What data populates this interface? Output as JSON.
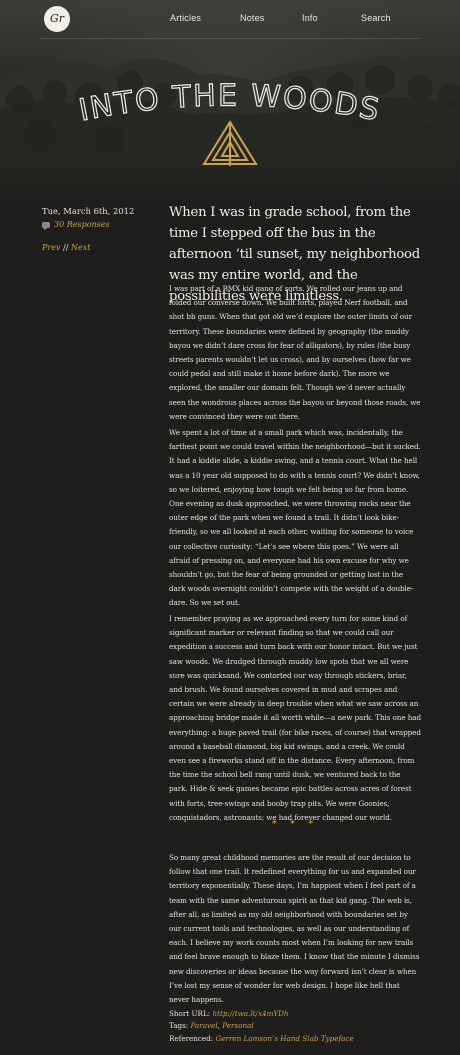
{
  "header": {
    "logo_text": "Gr",
    "nav": [
      {
        "label": "Articles"
      },
      {
        "label": "Notes"
      },
      {
        "label": "Info"
      },
      {
        "label": "Search"
      }
    ],
    "title": "INTO THE WOODS"
  },
  "meta": {
    "date": "Tue, March 6th, 2012",
    "responses": "30 Responses",
    "prev": "Prev",
    "separator": "//",
    "next": "Next"
  },
  "article": {
    "lede": "When I was in grade school, from the time I stepped off the bus in the afternoon ’til sunset, my neighborhood was my entire world, and the possibilities were limitless.",
    "paragraphs": [
      "I was part of a BMX kid gang of sorts. We rolled our jeans up and folded our converse down. We built forts, played Nerf football, and shot bb guns. When that got old we’d explore the outer limits of our territory. These boundaries were defined by geography (the muddy bayou we didn’t dare cross for fear of alligators), by rules (the busy streets parents wouldn’t let us cross), and by ourselves (how far we could pedal and still make it home before dark). The more we explored, the smaller our domain felt. Though we’d never actually seen the wondrous places across the bayou or beyond those roads, we were convinced they were out there.",
      "We spent a lot of time at a small park which was, incidentally, the farthest point we could travel within the neighborhood—but it sucked. It had a kiddie slide, a kiddie swing, and a tennis court. What the hell was a 10 year old supposed to do with a tennis court? We didn’t know, so we loitered, enjoying how tough we felt being so far from home. One evening as dusk approached, we were throwing rocks near the outer edge of the park when we found a trail. It didn’t look bike-friendly, so we all looked at each other, waiting for someone to voice our collective curiosity: “Let’s see where this goes.” We were all afraid of pressing on, and everyone had his own excuse for why we shouldn’t go, but the fear of being grounded or getting lost in the dark woods overnight couldn’t compete with the weight of a double-dare. So we set out.",
      "I remember praying as we approached every turn for some kind of significant marker or relevant finding so that we could call our expedition a success and turn back with our honor intact. But we just saw woods. We drudged through muddy low spots that we all were sure was quicksand. We contorted our way through stickers, briar, and brush. We found ourselves covered in mud and scrapes and certain we were already in deep trouble when what we saw across an approaching bridge made it all worth while—a new park. This one had everything: a huge paved trail (for bike races, of course) that wrapped around a baseball diamond, big kid swings, and a creek. We could even see a fireworks stand off in the distance. Every afternoon, from the time the school bell rang until dusk, we ventured back to the park. Hide & seek games became epic battles across acres of forest with forts, tree-swings and booby trap pits. We were Goonies, conquistadors, astronauts; we had forever changed our world.",
      "So many great childhood memories are the result of our decision to follow that one trail. It redefined everything for us and expanded our territory exponentially. These days, I’m happiest when I feel part of a team with the same adventurous spirit as that kid gang. The web is, after all, as limited as my old neighborhood with boundaries set by our current tools and technologies, as well as our understanding of each. I believe my work counts most when I’m looking for new trails and feel brave enough to blaze them. I know that the minute I dismiss new discoveries or ideas because the way forward isn’t clear is when I’ve lost my sense of wonder for web design. I hope like hell that never happens."
    ],
    "divider": "* * *"
  },
  "footer_meta": {
    "short_url_label": "Short URL:",
    "short_url": "http://twa.lt/x4mYDh",
    "tags_label": "Tags:",
    "tag_1": "Paravel",
    "tag_sep": ", ",
    "tag_2": "Personal",
    "referenced_label": "Referenced:",
    "referenced": "Gerren Lamson’s Hand Slab Typeface"
  },
  "colors": {
    "background": "#1f1e1c",
    "accent": "#c9a24d",
    "text": "#e6e2da"
  }
}
